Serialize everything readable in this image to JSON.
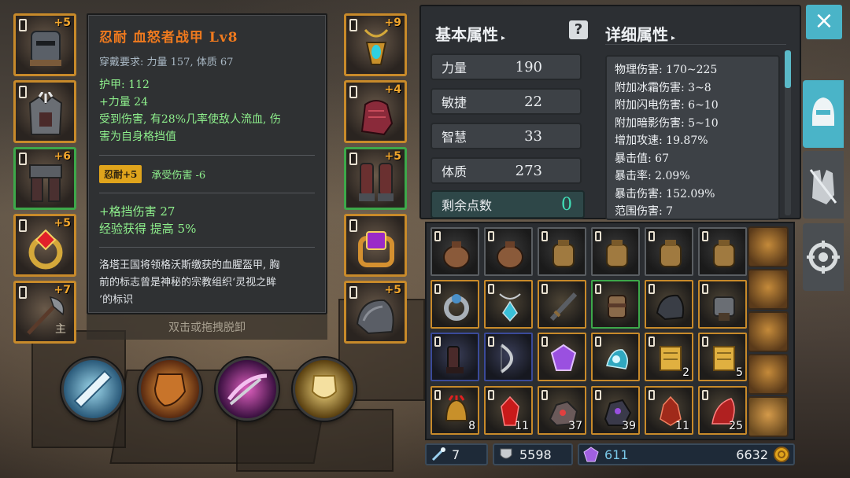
{
  "equip_left": [
    {
      "name": "helmet-slot",
      "plus": "+5",
      "border": "orange",
      "tag": ""
    },
    {
      "name": "chest-slot",
      "plus": "",
      "border": "orange",
      "tag": ""
    },
    {
      "name": "legs-slot",
      "plus": "+6",
      "border": "green",
      "tag": ""
    },
    {
      "name": "ring-slot",
      "plus": "+5",
      "border": "orange",
      "tag": ""
    },
    {
      "name": "weapon-slot",
      "plus": "+7",
      "border": "orange",
      "tag": "主"
    }
  ],
  "equip_right": [
    {
      "name": "amulet-slot",
      "plus": "+9",
      "border": "orange"
    },
    {
      "name": "gloves-slot",
      "plus": "+4",
      "border": "orange"
    },
    {
      "name": "boots-slot",
      "plus": "+5",
      "border": "green"
    },
    {
      "name": "ring2-slot",
      "plus": "",
      "border": "orange"
    },
    {
      "name": "shoulder-slot",
      "plus": "+5",
      "border": "orange"
    }
  ],
  "tooltip": {
    "title": "忍耐 血怒者战甲 Lv8",
    "requirement": "穿戴要求: 力量 157, 体质 67",
    "armor": "护甲: 112",
    "strength": "+力量 24",
    "effect_line1": "受到伤害, 有28%几率使敌人流血, 伤",
    "effect_line2": "害为自身格挡值",
    "badge": "忍耐+5",
    "badge_effect": "承受伤害 -6",
    "bonus1": "+格挡伤害 27",
    "bonus2": "经验获得 提高 5%",
    "desc_line1": "洛塔王国将领格沃斯缴获的血腥盔甲, 胸",
    "desc_line2": "前的标志曾是神秘的宗教组织‘灵视之眸",
    "desc_line3": "’的标识",
    "hint": "双击或拖拽脱卸"
  },
  "panel": {
    "basic_title": "基本属性",
    "detail_title": "详细属性",
    "help_icon": "?",
    "attributes": [
      {
        "label": "力量",
        "value": "190"
      },
      {
        "label": "敏捷",
        "value": "22"
      },
      {
        "label": "智慧",
        "value": "33"
      },
      {
        "label": "体质",
        "value": "273"
      }
    ],
    "remaining_label": "剩余点数",
    "remaining_value": "0",
    "details": [
      "物理伤害: 170~225",
      "附加冰霜伤害: 3~8",
      "附加闪电伤害: 6~10",
      "附加暗影伤害: 5~10",
      "增加攻速: 19.87%",
      "暴击值: 67",
      "暴击率: 2.09%",
      "暴击伤害: 152.09%",
      "范围伤害: 7"
    ]
  },
  "close_icon": "×",
  "inventory": {
    "rows": [
      [
        {
          "kind": "dark",
          "art": "pouch",
          "count": ""
        },
        {
          "kind": "dark",
          "art": "pouch",
          "count": ""
        },
        {
          "kind": "dark",
          "art": "bag",
          "count": ""
        },
        {
          "kind": "dark",
          "art": "bag",
          "count": ""
        },
        {
          "kind": "dark",
          "art": "bag",
          "count": ""
        },
        {
          "kind": "dark",
          "art": "bag",
          "count": ""
        }
      ],
      [
        {
          "kind": "orange",
          "art": "ring",
          "count": ""
        },
        {
          "kind": "orange",
          "art": "amulet",
          "count": ""
        },
        {
          "kind": "orange",
          "art": "sword",
          "count": ""
        },
        {
          "kind": "green",
          "art": "bracer",
          "count": ""
        },
        {
          "kind": "orange",
          "art": "shoulder",
          "count": ""
        },
        {
          "kind": "orange",
          "art": "gauntlet",
          "count": ""
        }
      ],
      [
        {
          "kind": "blue",
          "art": "boots",
          "count": ""
        },
        {
          "kind": "blue",
          "art": "bow",
          "count": ""
        },
        {
          "kind": "orange",
          "art": "gem",
          "count": ""
        },
        {
          "kind": "orange",
          "art": "relic",
          "count": ""
        },
        {
          "kind": "orange",
          "art": "scroll",
          "count": "2"
        },
        {
          "kind": "orange",
          "art": "scroll",
          "count": "5"
        }
      ],
      [
        {
          "kind": "orange",
          "art": "helm",
          "count": "8"
        },
        {
          "kind": "orange",
          "art": "crystal",
          "count": "11"
        },
        {
          "kind": "orange",
          "art": "ore",
          "count": "37"
        },
        {
          "kind": "orange",
          "art": "ore2",
          "count": "39"
        },
        {
          "kind": "orange",
          "art": "crystal2",
          "count": "11"
        },
        {
          "kind": "orange",
          "art": "crystal3",
          "count": "25"
        }
      ]
    ]
  },
  "currency": {
    "tool_value": "7",
    "shard_value": "5598",
    "gem_value": "611",
    "gold_value": "6632"
  },
  "colors": {
    "accent": "#4ab4c8",
    "rare_orange": "#c88a2a",
    "uncommon_green": "#3da84a",
    "magic_blue": "#3a4a9a",
    "title_orange": "#f07a1e",
    "stat_green": "#8ef08c",
    "points_teal": "#41e0b8"
  }
}
